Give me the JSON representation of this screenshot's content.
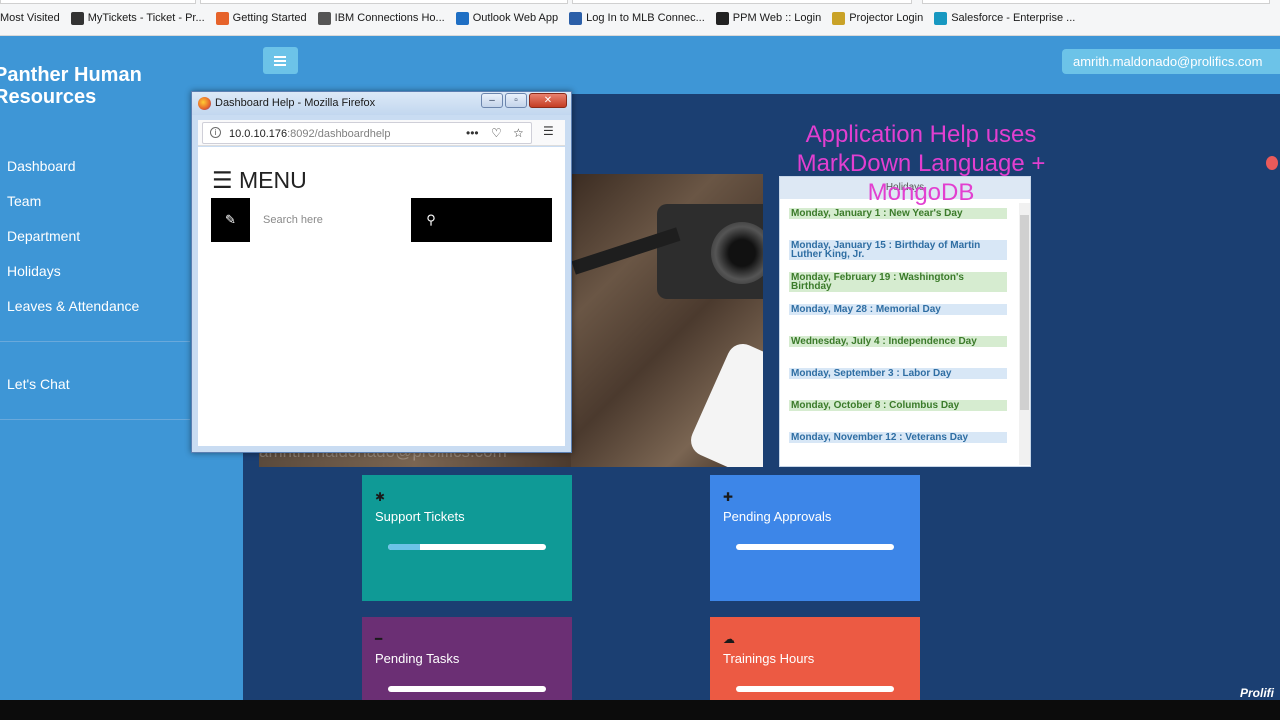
{
  "browser": {
    "bookmarks": [
      {
        "label": "Most Visited",
        "icon": "star-icon",
        "color": "#f5f6f7"
      },
      {
        "label": "MyTickets - Ticket - Pr...",
        "icon": "asterisk-icon",
        "color": "#333333"
      },
      {
        "label": "Getting Started",
        "icon": "firefox-icon",
        "color": "#e6632b"
      },
      {
        "label": "IBM Connections Ho...",
        "icon": "globe-icon",
        "color": "#555555"
      },
      {
        "label": "Outlook Web App",
        "icon": "outlook-icon",
        "color": "#1f6fc4"
      },
      {
        "label": "Log In to MLB Connec...",
        "icon": "mlb-icon",
        "color": "#2b5fa8"
      },
      {
        "label": "PPM Web :: Login",
        "icon": "ppm-icon",
        "color": "#222222"
      },
      {
        "label": "Projector Login",
        "icon": "projector-icon",
        "color": "#c9a227"
      },
      {
        "label": "Salesforce - Enterprise ...",
        "icon": "salesforce-icon",
        "color": "#1798c1"
      }
    ]
  },
  "header": {
    "user_email": "amrith.maldonado@prolifics.com"
  },
  "sidebar": {
    "brand": "Panther Human Resources",
    "items": [
      {
        "label": "Dashboard"
      },
      {
        "label": "Team"
      },
      {
        "label": "Department"
      },
      {
        "label": "Holidays"
      },
      {
        "label": "Leaves & Attendance"
      }
    ],
    "chat": "Let's Chat"
  },
  "main": {
    "overlay_text": "Application Help uses MarkDown Language + MongoDB",
    "photo_caption": "amrith.maldonado@prolifics.com",
    "holidays": {
      "title": "Holidays",
      "items": [
        {
          "text": "Monday, January 1 : New Year's Day",
          "color": "green"
        },
        {
          "text": "Monday, January 15 : Birthday of Martin Luther King, Jr.",
          "color": "blue"
        },
        {
          "text": "Monday, February 19 : Washington's Birthday",
          "color": "green"
        },
        {
          "text": "Monday, May 28 : Memorial Day",
          "color": "blue"
        },
        {
          "text": "Wednesday, July 4 : Independence Day",
          "color": "green"
        },
        {
          "text": "Monday, September 3 : Labor Day",
          "color": "blue"
        },
        {
          "text": "Monday, October 8 : Columbus Day",
          "color": "green"
        },
        {
          "text": "Monday, November 12 : Veterans Day",
          "color": "blue"
        }
      ]
    },
    "tiles": [
      {
        "label": "Support Tickets",
        "icon": "asterisk-icon",
        "color": "#0f9a96",
        "progress": 0.2,
        "fill": "#6cc3e8"
      },
      {
        "label": "Pending Approvals",
        "icon": "plus-icon",
        "color": "#3d86e8",
        "progress": 0,
        "fill": "#6cc3e8"
      },
      {
        "label": "Pending Tasks",
        "icon": "minus-icon",
        "color": "#6b2f74",
        "progress": 0,
        "fill": "#6cc3e8"
      },
      {
        "label": "Trainings Hours",
        "icon": "cloud-icon",
        "color": "#ec5a43",
        "progress": 0,
        "fill": "#6cc3e8"
      }
    ],
    "logo": "Prolifi"
  },
  "popup": {
    "window_title": "Dashboard Help - Mozilla Firefox",
    "url_host": "10.0.10.176",
    "url_path": ":8092/dashboardhelp",
    "menu_label": "☰ MENU",
    "search_placeholder": "Search here"
  }
}
